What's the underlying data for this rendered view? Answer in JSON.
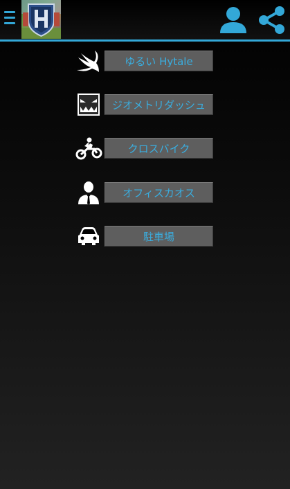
{
  "appbar": {
    "menu_icon": "hamburger-icon",
    "logo_icon": "hytale-logo",
    "profile_icon": "person-icon",
    "share_icon": "share-icon",
    "accent": "#33a8d8"
  },
  "menu": {
    "items": [
      {
        "label": "ゆるい Hytale",
        "icon": "swift-bird-icon"
      },
      {
        "label": "ジオメトリダッシュ",
        "icon": "geometry-face-icon"
      },
      {
        "label": "クロスバイク",
        "icon": "motocross-icon"
      },
      {
        "label": "オフィスカオス",
        "icon": "businessman-icon"
      },
      {
        "label": "駐車場",
        "icon": "car-icon"
      }
    ]
  },
  "colors": {
    "button_bg": "#5e5e5e",
    "button_text": "#3aaee0",
    "background_top": "#000000",
    "background_bottom": "#222222"
  }
}
